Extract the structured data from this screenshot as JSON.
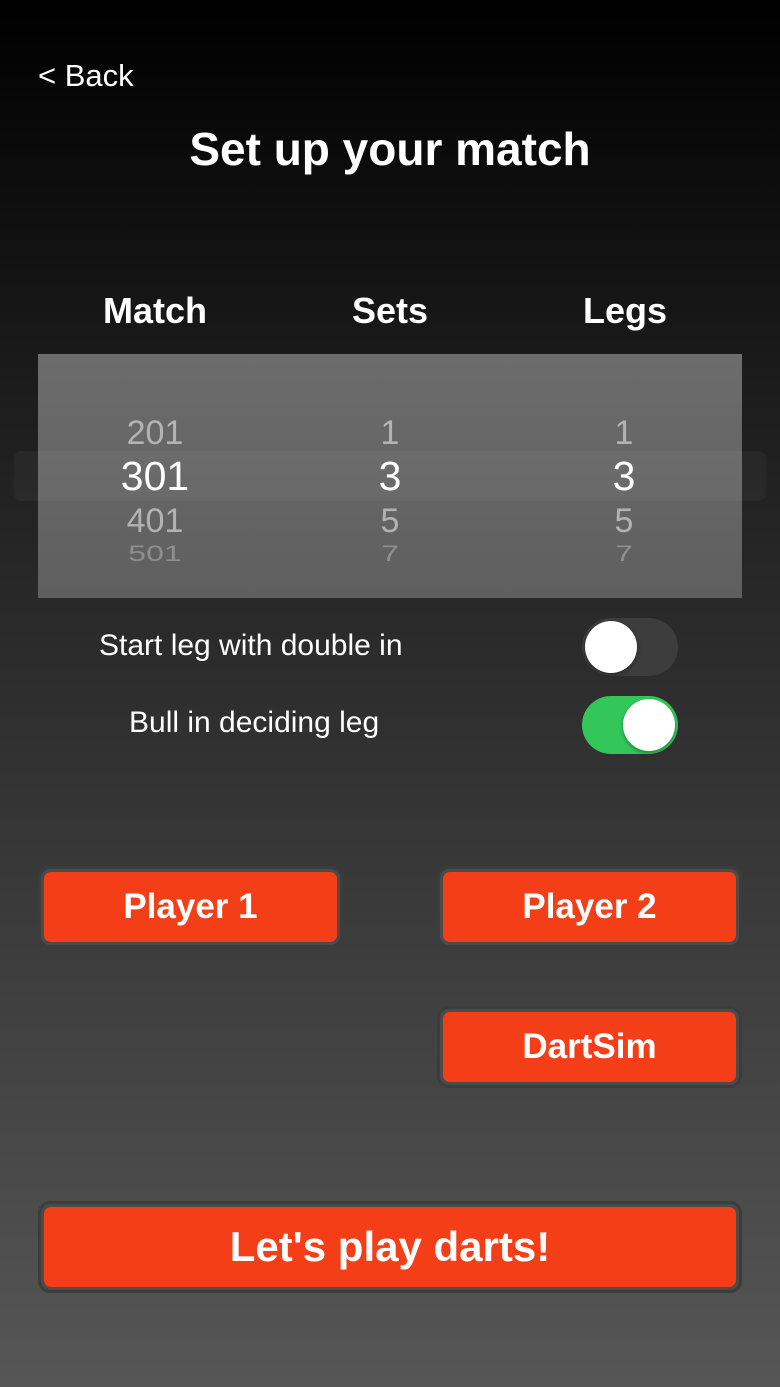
{
  "header": {
    "back_label": "< Back",
    "title": "Set up your match"
  },
  "picker": {
    "columns": [
      {
        "header": "Match",
        "items": [
          "201",
          "301",
          "401",
          "501"
        ],
        "selected": "301"
      },
      {
        "header": "Sets",
        "items": [
          "1",
          "3",
          "5",
          "7"
        ],
        "selected": "3"
      },
      {
        "header": "Legs",
        "items": [
          "1",
          "3",
          "5",
          "7"
        ],
        "selected": "3"
      }
    ]
  },
  "settings": {
    "double_in": {
      "label": "Start leg with double in",
      "on": false
    },
    "bull_deciding": {
      "label": "Bull in deciding leg",
      "on": true
    }
  },
  "buttons": {
    "player1": "Player 1",
    "player2": "Player 2",
    "dartsim": "DartSim",
    "play": "Let's play darts!"
  },
  "colors": {
    "accent": "#f43e17",
    "toggle_on": "#33c759",
    "toggle_off": "#3d3d3d"
  }
}
